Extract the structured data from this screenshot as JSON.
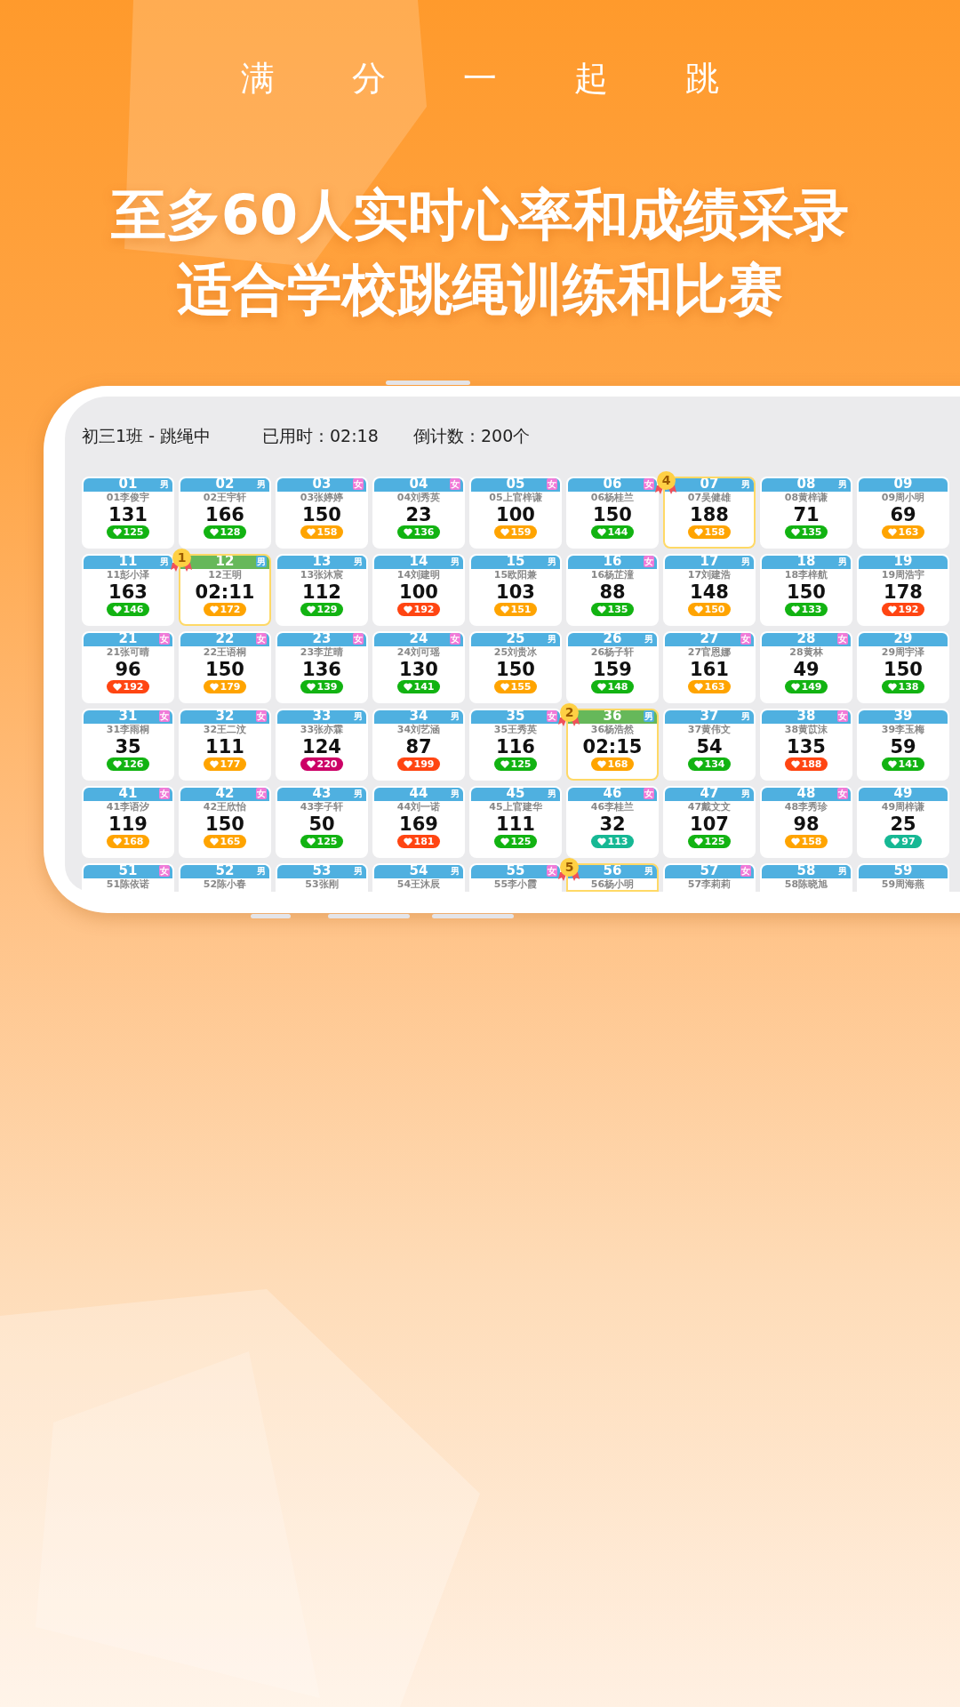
{
  "slogan": "满分一起跳",
  "headline": [
    "至多60人实时心率和成绩采录",
    "适合学校跳绳训练和比赛"
  ],
  "status": {
    "session": "初三1班 - 跳绳中",
    "elapsed": "已用时：02:18",
    "countdown": "倒计数：200个"
  },
  "students": [
    {
      "number": "01",
      "tag": {
        "text": "男",
        "kind": "male"
      },
      "name": "01李俊宇",
      "score": "131",
      "heart_rate": {
        "text": "125",
        "color": "#12b312"
      },
      "finished": false
    },
    {
      "number": "02",
      "tag": {
        "text": "男",
        "kind": "male"
      },
      "name": "02王宇轩",
      "score": "166",
      "heart_rate": {
        "text": "128",
        "color": "#12b312"
      },
      "finished": false
    },
    {
      "number": "03",
      "tag": {
        "text": "女",
        "kind": "female"
      },
      "name": "03张婷婷",
      "score": "150",
      "heart_rate": {
        "text": "158",
        "color": "#ffa400"
      },
      "finished": false
    },
    {
      "number": "04",
      "tag": {
        "text": "女",
        "kind": "female"
      },
      "name": "04刘秀英",
      "score": "23",
      "heart_rate": {
        "text": "136",
        "color": "#12b312"
      },
      "finished": false
    },
    {
      "number": "05",
      "tag": {
        "text": "女",
        "kind": "female"
      },
      "name": "05上官梓谦",
      "score": "100",
      "heart_rate": {
        "text": "159",
        "color": "#ffa400"
      },
      "finished": false
    },
    {
      "number": "06",
      "tag": {
        "text": "女",
        "kind": "female"
      },
      "name": "06杨桂兰",
      "score": "150",
      "heart_rate": {
        "text": "144",
        "color": "#12b312"
      },
      "finished": false
    },
    {
      "number": "07",
      "tag": {
        "text": "男",
        "kind": "male"
      },
      "name": "07吴健雄",
      "score": "188",
      "heart_rate": {
        "text": "158",
        "color": "#ffa400"
      },
      "finished": false,
      "rank": "4"
    },
    {
      "number": "08",
      "tag": {
        "text": "男",
        "kind": "male"
      },
      "name": "08黄梓谦",
      "score": "71",
      "heart_rate": {
        "text": "135",
        "color": "#12b312"
      },
      "finished": false
    },
    {
      "number": "09",
      "name": "09周小明",
      "score": "69",
      "heart_rate": {
        "text": "163",
        "color": "#ffa400"
      },
      "finished": false
    },
    {
      "number": "11",
      "tag": {
        "text": "男",
        "kind": "male"
      },
      "name": "11彭小泽",
      "score": "163",
      "heart_rate": {
        "text": "146",
        "color": "#12b312"
      },
      "finished": false
    },
    {
      "number": "12",
      "tag": {
        "text": "男",
        "kind": "male"
      },
      "name": "12王明",
      "score": "02:11",
      "heart_rate": {
        "text": "172",
        "color": "#ffa400"
      },
      "finished": true,
      "rank": "1"
    },
    {
      "number": "13",
      "tag": {
        "text": "男",
        "kind": "male"
      },
      "name": "13张沐宸",
      "score": "112",
      "heart_rate": {
        "text": "129",
        "color": "#12b312"
      },
      "finished": false
    },
    {
      "number": "14",
      "tag": {
        "text": "男",
        "kind": "male"
      },
      "name": "14刘建明",
      "score": "100",
      "heart_rate": {
        "text": "192",
        "color": "#ff4512"
      },
      "finished": false
    },
    {
      "number": "15",
      "tag": {
        "text": "男",
        "kind": "male"
      },
      "name": "15欧阳兼",
      "score": "103",
      "heart_rate": {
        "text": "151",
        "color": "#ffa400"
      },
      "finished": false
    },
    {
      "number": "16",
      "tag": {
        "text": "女",
        "kind": "female"
      },
      "name": "16杨芷潼",
      "score": "88",
      "heart_rate": {
        "text": "135",
        "color": "#12b312"
      },
      "finished": false
    },
    {
      "number": "17",
      "tag": {
        "text": "男",
        "kind": "male"
      },
      "name": "17刘建浩",
      "score": "148",
      "heart_rate": {
        "text": "150",
        "color": "#ffa400"
      },
      "finished": false
    },
    {
      "number": "18",
      "tag": {
        "text": "男",
        "kind": "male"
      },
      "name": "18李梓航",
      "score": "150",
      "heart_rate": {
        "text": "133",
        "color": "#12b312"
      },
      "finished": false
    },
    {
      "number": "19",
      "name": "19周浩宇",
      "score": "178",
      "heart_rate": {
        "text": "192",
        "color": "#ff4512"
      },
      "finished": false
    },
    {
      "number": "21",
      "tag": {
        "text": "女",
        "kind": "female"
      },
      "name": "21张可晴",
      "score": "96",
      "heart_rate": {
        "text": "192",
        "color": "#ff4512"
      },
      "finished": false
    },
    {
      "number": "22",
      "tag": {
        "text": "女",
        "kind": "female"
      },
      "name": "22王语桐",
      "score": "150",
      "heart_rate": {
        "text": "179",
        "color": "#ffa400"
      },
      "finished": false
    },
    {
      "number": "23",
      "tag": {
        "text": "女",
        "kind": "female"
      },
      "name": "23李芷晴",
      "score": "136",
      "heart_rate": {
        "text": "139",
        "color": "#12b312"
      },
      "finished": false
    },
    {
      "number": "24",
      "tag": {
        "text": "女",
        "kind": "female"
      },
      "name": "24刘可瑶",
      "score": "130",
      "heart_rate": {
        "text": "141",
        "color": "#12b312"
      },
      "finished": false
    },
    {
      "number": "25",
      "tag": {
        "text": "男",
        "kind": "male"
      },
      "name": "25刘贵冰",
      "score": "150",
      "heart_rate": {
        "text": "155",
        "color": "#ffa400"
      },
      "finished": false
    },
    {
      "number": "26",
      "tag": {
        "text": "男",
        "kind": "male"
      },
      "name": "26杨子轩",
      "score": "159",
      "heart_rate": {
        "text": "148",
        "color": "#12b312"
      },
      "finished": false
    },
    {
      "number": "27",
      "tag": {
        "text": "女",
        "kind": "female"
      },
      "name": "27官恩娜",
      "score": "161",
      "heart_rate": {
        "text": "163",
        "color": "#ffa400"
      },
      "finished": false
    },
    {
      "number": "28",
      "tag": {
        "text": "女",
        "kind": "female"
      },
      "name": "28黄林",
      "score": "49",
      "heart_rate": {
        "text": "149",
        "color": "#12b312"
      },
      "finished": false
    },
    {
      "number": "29",
      "name": "29周宇泽",
      "score": "150",
      "heart_rate": {
        "text": "138",
        "color": "#12b312"
      },
      "finished": false
    },
    {
      "number": "31",
      "tag": {
        "text": "女",
        "kind": "female"
      },
      "name": "31李雨桐",
      "score": "35",
      "heart_rate": {
        "text": "126",
        "color": "#12b312"
      },
      "finished": false
    },
    {
      "number": "32",
      "tag": {
        "text": "女",
        "kind": "female"
      },
      "name": "32王二汶",
      "score": "111",
      "heart_rate": {
        "text": "177",
        "color": "#ffa400"
      },
      "finished": false
    },
    {
      "number": "33",
      "tag": {
        "text": "男",
        "kind": "male"
      },
      "name": "33张亦霖",
      "score": "124",
      "heart_rate": {
        "text": "220",
        "color": "#cc0066"
      },
      "finished": false
    },
    {
      "number": "34",
      "tag": {
        "text": "男",
        "kind": "male"
      },
      "name": "34刘艺涵",
      "score": "87",
      "heart_rate": {
        "text": "199",
        "color": "#ff4512"
      },
      "finished": false
    },
    {
      "number": "35",
      "tag": {
        "text": "女",
        "kind": "female"
      },
      "name": "35王秀英",
      "score": "116",
      "heart_rate": {
        "text": "125",
        "color": "#12b312"
      },
      "finished": false
    },
    {
      "number": "36",
      "tag": {
        "text": "男",
        "kind": "male"
      },
      "name": "36杨浩然",
      "score": "02:15",
      "heart_rate": {
        "text": "168",
        "color": "#ffa400"
      },
      "finished": true,
      "rank": "2"
    },
    {
      "number": "37",
      "tag": {
        "text": "男",
        "kind": "male"
      },
      "name": "37黄伟文",
      "score": "54",
      "heart_rate": {
        "text": "134",
        "color": "#12b312"
      },
      "finished": false
    },
    {
      "number": "38",
      "tag": {
        "text": "女",
        "kind": "female"
      },
      "name": "38黄苡沫",
      "score": "135",
      "heart_rate": {
        "text": "188",
        "color": "#ff4512"
      },
      "finished": false
    },
    {
      "number": "39",
      "name": "39李玉梅",
      "score": "59",
      "heart_rate": {
        "text": "141",
        "color": "#12b312"
      },
      "finished": false
    },
    {
      "number": "41",
      "tag": {
        "text": "女",
        "kind": "female"
      },
      "name": "41李语汐",
      "score": "119",
      "heart_rate": {
        "text": "168",
        "color": "#ffa400"
      },
      "finished": false
    },
    {
      "number": "42",
      "tag": {
        "text": "女",
        "kind": "female"
      },
      "name": "42王欣怡",
      "score": "150",
      "heart_rate": {
        "text": "165",
        "color": "#ffa400"
      },
      "finished": false
    },
    {
      "number": "43",
      "tag": {
        "text": "男",
        "kind": "male"
      },
      "name": "43李子轩",
      "score": "50",
      "heart_rate": {
        "text": "125",
        "color": "#12b312"
      },
      "finished": false
    },
    {
      "number": "44",
      "tag": {
        "text": "男",
        "kind": "male"
      },
      "name": "44刘一诺",
      "score": "169",
      "heart_rate": {
        "text": "181",
        "color": "#ff4512"
      },
      "finished": false
    },
    {
      "number": "45",
      "tag": {
        "text": "男",
        "kind": "male"
      },
      "name": "45上官建华",
      "score": "111",
      "heart_rate": {
        "text": "125",
        "color": "#12b312"
      },
      "finished": false
    },
    {
      "number": "46",
      "tag": {
        "text": "女",
        "kind": "female"
      },
      "name": "46李桂兰",
      "score": "32",
      "heart_rate": {
        "text": "113",
        "color": "#16b894"
      },
      "finished": false
    },
    {
      "number": "47",
      "tag": {
        "text": "男",
        "kind": "male"
      },
      "name": "47戴文文",
      "score": "107",
      "heart_rate": {
        "text": "125",
        "color": "#12b312"
      },
      "finished": false
    },
    {
      "number": "48",
      "tag": {
        "text": "女",
        "kind": "female"
      },
      "name": "48李秀珍",
      "score": "98",
      "heart_rate": {
        "text": "158",
        "color": "#ffa400"
      },
      "finished": false
    },
    {
      "number": "49",
      "name": "49周梓谦",
      "score": "25",
      "heart_rate": {
        "text": "97",
        "color": "#16b894"
      },
      "finished": false
    },
    {
      "number": "51",
      "tag": {
        "text": "女",
        "kind": "female"
      },
      "name": "51陈依诺",
      "finished": false
    },
    {
      "number": "52",
      "tag": {
        "text": "男",
        "kind": "male"
      },
      "name": "52陈小春",
      "finished": false
    },
    {
      "number": "53",
      "tag": {
        "text": "男",
        "kind": "male"
      },
      "name": "53张刚",
      "finished": false
    },
    {
      "number": "54",
      "tag": {
        "text": "男",
        "kind": "male"
      },
      "name": "54王沐辰",
      "finished": false
    },
    {
      "number": "55",
      "tag": {
        "text": "女",
        "kind": "female"
      },
      "name": "55李小霞",
      "finished": false
    },
    {
      "number": "56",
      "tag": {
        "text": "男",
        "kind": "male"
      },
      "name": "56杨小明",
      "finished": false,
      "rank": "5"
    },
    {
      "number": "57",
      "tag": {
        "text": "女",
        "kind": "female"
      },
      "name": "57李莉莉",
      "finished": false
    },
    {
      "number": "58",
      "tag": {
        "text": "男",
        "kind": "male"
      },
      "name": "58陈晓旭",
      "finished": false
    },
    {
      "number": "59",
      "name": "59周海燕",
      "finished": false
    }
  ]
}
